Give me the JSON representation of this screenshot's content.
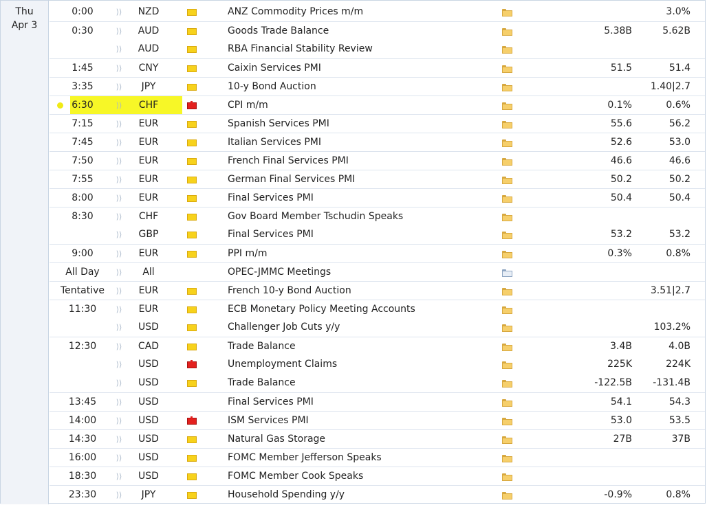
{
  "date": {
    "weekday": "Thu",
    "day": "Apr 3"
  },
  "colors": {
    "highlight": "#f7f727",
    "low_impact": "#f7d21c",
    "medium_impact": "#f08d36",
    "high_impact": "#e3211f"
  },
  "events": [
    {
      "time": "0:00",
      "currency": "NZD",
      "impact": "low",
      "event": "ANZ Commodity Prices m/m",
      "forecast": "",
      "previous": "3.0%"
    },
    {
      "time": "0:30",
      "currency": "AUD",
      "impact": "low",
      "event": "Goods Trade Balance",
      "forecast": "5.38B",
      "previous": "5.62B"
    },
    {
      "time": "",
      "currency": "AUD",
      "impact": "low",
      "event": "RBA Financial Stability Review",
      "forecast": "",
      "previous": ""
    },
    {
      "time": "1:45",
      "currency": "CNY",
      "impact": "low",
      "event": "Caixin Services PMI",
      "forecast": "51.5",
      "previous": "51.4"
    },
    {
      "time": "3:35",
      "currency": "JPY",
      "impact": "low",
      "event": "10-y Bond Auction",
      "forecast": "",
      "previous": "1.40|2.7"
    },
    {
      "time": "6:30",
      "currency": "CHF",
      "impact": "high",
      "event": "CPI m/m",
      "forecast": "0.1%",
      "previous": "0.6%",
      "highlighted": true
    },
    {
      "time": "7:15",
      "currency": "EUR",
      "impact": "low",
      "event": "Spanish Services PMI",
      "forecast": "55.6",
      "previous": "56.2"
    },
    {
      "time": "7:45",
      "currency": "EUR",
      "impact": "low",
      "event": "Italian Services PMI",
      "forecast": "52.6",
      "previous": "53.0"
    },
    {
      "time": "7:50",
      "currency": "EUR",
      "impact": "low",
      "event": "French Final Services PMI",
      "forecast": "46.6",
      "previous": "46.6"
    },
    {
      "time": "7:55",
      "currency": "EUR",
      "impact": "low",
      "event": "German Final Services PMI",
      "forecast": "50.2",
      "previous": "50.2"
    },
    {
      "time": "8:00",
      "currency": "EUR",
      "impact": "low",
      "event": "Final Services PMI",
      "forecast": "50.4",
      "previous": "50.4"
    },
    {
      "time": "8:30",
      "currency": "CHF",
      "impact": "low",
      "event": "Gov Board Member Tschudin Speaks",
      "forecast": "",
      "previous": ""
    },
    {
      "time": "",
      "currency": "GBP",
      "impact": "low",
      "event": "Final Services PMI",
      "forecast": "53.2",
      "previous": "53.2"
    },
    {
      "time": "9:00",
      "currency": "EUR",
      "impact": "low",
      "event": "PPI m/m",
      "forecast": "0.3%",
      "previous": "0.8%"
    },
    {
      "time": "All Day",
      "currency": "All",
      "impact": "medium",
      "event": "OPEC-JMMC Meetings",
      "forecast": "",
      "previous": "",
      "detail_icon": "graph"
    },
    {
      "time": "Tentative",
      "currency": "EUR",
      "impact": "low",
      "event": "French 10-y Bond Auction",
      "forecast": "",
      "previous": "3.51|2.7"
    },
    {
      "time": "11:30",
      "currency": "EUR",
      "impact": "low",
      "event": "ECB Monetary Policy Meeting Accounts",
      "forecast": "",
      "previous": ""
    },
    {
      "time": "",
      "currency": "USD",
      "impact": "low",
      "event": "Challenger Job Cuts y/y",
      "forecast": "",
      "previous": "103.2%"
    },
    {
      "time": "12:30",
      "currency": "CAD",
      "impact": "low",
      "event": "Trade Balance",
      "forecast": "3.4B",
      "previous": "4.0B"
    },
    {
      "time": "",
      "currency": "USD",
      "impact": "high",
      "event": "Unemployment Claims",
      "forecast": "225K",
      "previous": "224K"
    },
    {
      "time": "",
      "currency": "USD",
      "impact": "low",
      "event": "Trade Balance",
      "forecast": "-122.5B",
      "previous": "-131.4B"
    },
    {
      "time": "13:45",
      "currency": "USD",
      "impact": "medium",
      "event": "Final Services PMI",
      "forecast": "54.1",
      "previous": "54.3"
    },
    {
      "time": "14:00",
      "currency": "USD",
      "impact": "high",
      "event": "ISM Services PMI",
      "forecast": "53.0",
      "previous": "53.5"
    },
    {
      "time": "14:30",
      "currency": "USD",
      "impact": "low",
      "event": "Natural Gas Storage",
      "forecast": "27B",
      "previous": "37B"
    },
    {
      "time": "16:00",
      "currency": "USD",
      "impact": "low",
      "event": "FOMC Member Jefferson Speaks",
      "forecast": "",
      "previous": ""
    },
    {
      "time": "18:30",
      "currency": "USD",
      "impact": "low",
      "event": "FOMC Member Cook Speaks",
      "forecast": "",
      "previous": ""
    },
    {
      "time": "23:30",
      "currency": "JPY",
      "impact": "low",
      "event": "Household Spending y/y",
      "forecast": "-0.9%",
      "previous": "0.8%"
    }
  ],
  "icons": {
    "speaker": "sound-icon",
    "impact": "impact-folder-icon",
    "detail": "detail-folder-icon"
  }
}
